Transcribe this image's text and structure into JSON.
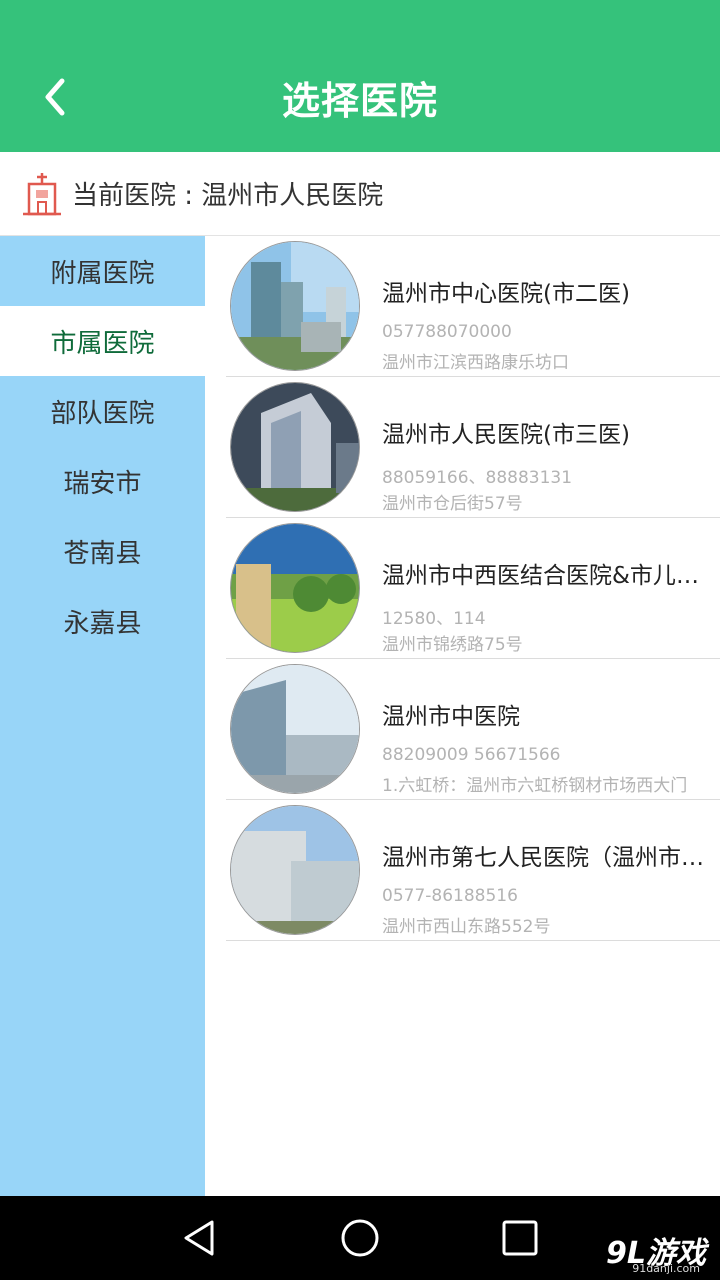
{
  "header": {
    "title": "选择医院",
    "back_icon": "chevron-left-icon"
  },
  "current_hospital": {
    "label": "当前医院 : 温州市人民医院",
    "icon": "hospital-icon"
  },
  "categories": [
    {
      "label": "附属医院",
      "active": false
    },
    {
      "label": "市属医院",
      "active": true
    },
    {
      "label": "部队医院",
      "active": false
    },
    {
      "label": "瑞安市",
      "active": false
    },
    {
      "label": "苍南县",
      "active": false
    },
    {
      "label": "永嘉县",
      "active": false
    }
  ],
  "hospitals": [
    {
      "name": "温州市中心医院(市二医)",
      "phone": "057788070000",
      "address": "温州市江滨西路康乐坊口"
    },
    {
      "name": "温州市人民医院(市三医)",
      "phone": "88059166、88883131",
      "address": "温州市仓后街57号"
    },
    {
      "name": "温州市中西医结合医院&市儿童医院",
      "phone": "12580、114",
      "address": "温州市锦绣路75号"
    },
    {
      "name": "温州市中医院",
      "phone": "88209009 56671566",
      "address": "1.六虹桥：温州市六虹桥钢材市场西大门"
    },
    {
      "name": "温州市第七人民医院（温州市精神病医院）",
      "phone": "0577-86188516",
      "address": "温州市西山东路552号"
    }
  ],
  "watermark": {
    "logo": "9L游戏",
    "site": "91danji.com"
  },
  "colors": {
    "header": "#35c27b",
    "sidebar": "#98d5f8",
    "active_text": "#0f6b3a"
  },
  "nav": {
    "back_icon": "triangle-back-icon",
    "home_icon": "circle-home-icon",
    "recents_icon": "square-recents-icon"
  }
}
